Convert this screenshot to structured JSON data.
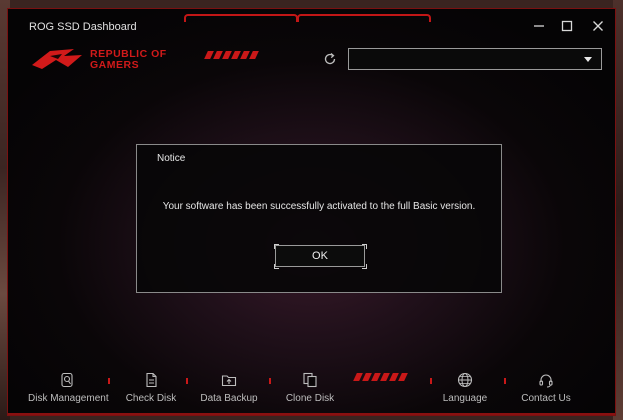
{
  "app": {
    "title": "ROG SSD Dashboard"
  },
  "brand": {
    "line1": "REPUBLIC OF",
    "line2": "GAMERS"
  },
  "window_controls": {
    "minimize": "—",
    "maximize": "☐",
    "close": "✕"
  },
  "drive_select": {
    "selected": ""
  },
  "dialog": {
    "title": "Notice",
    "message": "Your software has been successfully activated to the full Basic version.",
    "ok_label": "OK"
  },
  "nav": {
    "items": [
      {
        "label": "Disk Management",
        "icon": "disk-management-icon"
      },
      {
        "label": "Check Disk",
        "icon": "check-disk-icon"
      },
      {
        "label": "Data Backup",
        "icon": "data-backup-icon"
      },
      {
        "label": "Clone Disk",
        "icon": "clone-disk-icon"
      },
      {
        "label": "Language",
        "icon": "globe-icon"
      },
      {
        "label": "Contact Us",
        "icon": "headset-icon"
      }
    ]
  },
  "colors": {
    "accent": "#c91818",
    "text": "#e6e6e6",
    "nav_text": "#bdbdbd"
  }
}
